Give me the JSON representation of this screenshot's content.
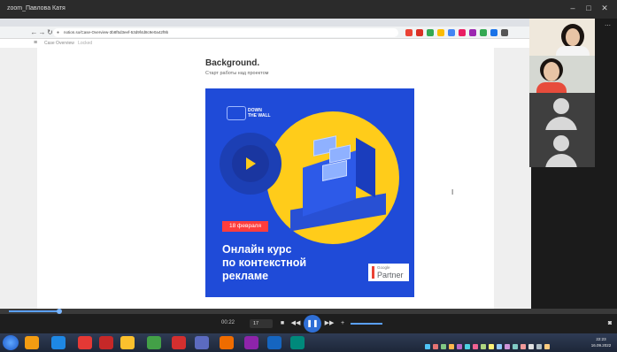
{
  "player": {
    "title": "zoom_Павлова Катя",
    "current_time": "00:22",
    "playlist_count": "17",
    "window_controls": [
      "–",
      "□",
      "✕"
    ]
  },
  "browser": {
    "url": "notion.so/Case-Overview-3b8f5d3eef-53d9f4d8c9e0a42f9b",
    "breadcrumb": "Case Overview",
    "breadcrumb_extra": "Locked"
  },
  "page": {
    "heading": "Background.",
    "subheading": "Старт работы над проектом"
  },
  "promo": {
    "logo_text_1": "DOWN",
    "logo_text_2": "THE WALL",
    "date_badge": "18 февраля",
    "headline_1": "Онлайн курс",
    "headline_2": "по контекстной",
    "headline_3": "рекламе",
    "partner_small": "Google",
    "partner_big": "Partner",
    "colors": {
      "background": "#1f4bd8",
      "accent": "#ffcc1a",
      "badge": "#ff3d3d"
    }
  },
  "taskbar": {
    "time": "22:23",
    "date": "16.09.2022"
  },
  "icons": [
    "search-icon",
    "play-icon",
    "pause-icon",
    "stop-icon",
    "rewind-icon",
    "fast-forward-icon",
    "volume-icon",
    "fullscreen-icon",
    "menu-icon",
    "lock-icon"
  ]
}
